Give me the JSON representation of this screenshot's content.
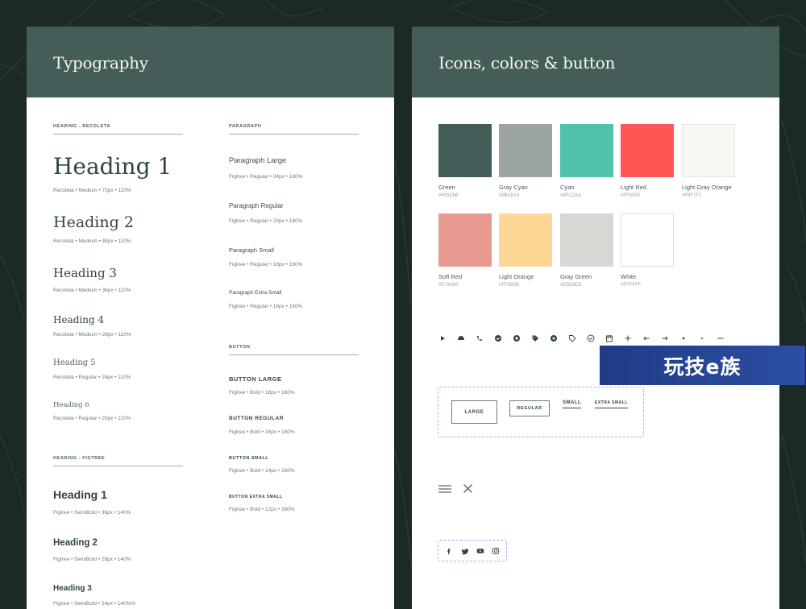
{
  "typography": {
    "title": "Typography",
    "recoleta_label": "HEADING - RECOLETA",
    "figtree_label": "HEADING - FIGTREE",
    "paragraph_label": "PARAGRAPH",
    "button_label": "BUTTON",
    "recoleta_headings": [
      {
        "name": "Heading 1",
        "spec": "Recoleta  •  Medium  •  72px  •  110%"
      },
      {
        "name": "Heading 2",
        "spec": "Recoleta  •  Medium  •  48px  •  110%"
      },
      {
        "name": "Heading 3",
        "spec": "Recoleta  •  Medium  •  36px  •  110%"
      },
      {
        "name": "Heading 4",
        "spec": "Recoleta  •  Medium  •  28px  •  110%"
      },
      {
        "name": "Heading 5",
        "spec": "Recoleta  •  Regular  •  24px  •  110%"
      },
      {
        "name": "Heading 6",
        "spec": "Recoleta  •  Regular  •  20px  •  110%"
      }
    ],
    "figtree_headings": [
      {
        "name": "Heading 1",
        "spec": "Figtree  •  SemiBold  •  36px  •  140%"
      },
      {
        "name": "Heading 2",
        "spec": "Figtree  •  SemiBold  •  28px  •  140%"
      },
      {
        "name": "Heading 3",
        "spec": "Figtree  •  SemiBold  •  24px  •  140%%"
      }
    ],
    "paragraphs": [
      {
        "name": "Paragraph Large",
        "spec": "Figtree  •  Regular  •  24px  •  160%"
      },
      {
        "name": "Paragraph Regular",
        "spec": "Figtree  •  Regular  •  20px  •  160%"
      },
      {
        "name": "Paragraph Small",
        "spec": "Figtree  •  Regular  •  18px  •  160%"
      },
      {
        "name": "Paragraph Extra Small",
        "spec": "Figtree  •  Regular  •  16px  •  160%"
      }
    ],
    "buttons": [
      {
        "name": "BUTTON LARGE",
        "spec": "Figtree  •  Bold  •  18px  •  160%"
      },
      {
        "name": "BUTTON REGULAR",
        "spec": "Figtree  •  Bold  •  16px  •  160%"
      },
      {
        "name": "BUTTON SMALL",
        "spec": "Figtree  •  Bold  •  14px  •  160%"
      },
      {
        "name": "BUTTON EXTRA SMALL",
        "spec": "Figtree  •  Bold  •  12px  •  160%"
      }
    ]
  },
  "icons_panel": {
    "title": "Icons, colors & button",
    "swatches": [
      {
        "name": "Green",
        "hex": "#455D58",
        "color": "#455d58"
      },
      {
        "name": "Gray Cyan",
        "hex": "#9BA5A3",
        "color": "#9ba5a3"
      },
      {
        "name": "Cyan",
        "hex": "#4FC2AA",
        "color": "#4fc2aa"
      },
      {
        "name": "Light Red",
        "hex": "#FF5555",
        "color": "#ff5555"
      },
      {
        "name": "Light Gray Orange",
        "hex": "#F9F7F2",
        "color": "#f9f7f2"
      },
      {
        "name": "Soft Red",
        "hex": "#E79A90",
        "color": "#e79a90"
      },
      {
        "name": "Light Orange",
        "hex": "#FFD696",
        "color": "#ffd696"
      },
      {
        "name": "Gray Green",
        "hex": "#D5D8D3",
        "color": "#d5d8d3"
      },
      {
        "name": "White",
        "hex": "#FFFFFF",
        "color": "#ffffff"
      }
    ],
    "icons": [
      "play-icon",
      "cloud-icon",
      "phone-icon",
      "check-circle-icon",
      "record-icon",
      "tag-filled-icon",
      "plus-circle-icon",
      "tag-outline-icon",
      "check-outline-icon",
      "calendar-icon",
      "plus-icon",
      "arrow-left-icon",
      "arrow-right-icon",
      "dot-icon",
      "small-dot-icon",
      "minus-icon"
    ],
    "demo_buttons": {
      "large": "LARGE",
      "regular": "REGULAR",
      "small": "SMALL",
      "extra_small": "EXTRA SMALL"
    },
    "social_icons": [
      "facebook-icon",
      "twitter-icon",
      "youtube-icon",
      "instagram-icon"
    ]
  },
  "watermark": "玩技e族"
}
